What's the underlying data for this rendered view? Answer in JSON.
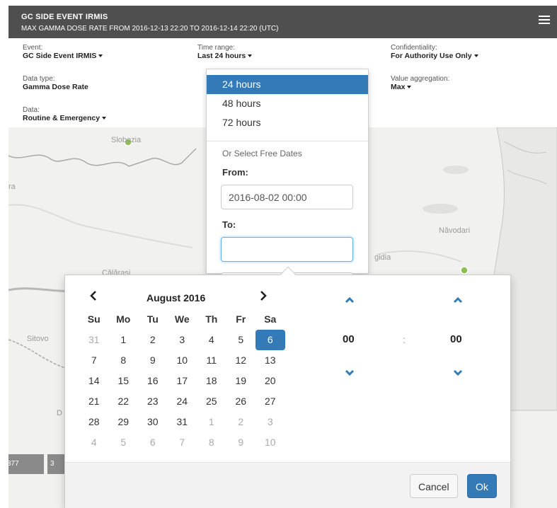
{
  "header": {
    "title": "GC SIDE EVENT IRMIS",
    "subtitle": "MAX GAMMA DOSE RATE FROM 2016-12-13 22:20 TO 2016-12-14 22:20 (UTC)"
  },
  "filters": {
    "event": {
      "label": "Event:",
      "value": "GC Side Event IRMIS"
    },
    "data_type": {
      "label": "Data type:",
      "value": "Gamma Dose Rate"
    },
    "data": {
      "label": "Data:",
      "value": "Routine & Emergency"
    },
    "time_range": {
      "label": "Time range:",
      "value": "Last 24 hours"
    },
    "confidentiality": {
      "label": "Confidentiality:",
      "value": "For Authority Use Only"
    },
    "aggregation": {
      "label": "Value aggregation:",
      "value": "Max"
    }
  },
  "dropdown": {
    "options": [
      "24 hours",
      "48 hours",
      "72 hours"
    ],
    "selected_index": 0,
    "free_dates_hint": "Or Select Free Dates",
    "from_label": "From:",
    "from_value": "2016-08-02 00:00",
    "to_label": "To:",
    "to_value": ""
  },
  "map": {
    "labels": [
      "Slobozia",
      "Călărași",
      "Sitovo",
      "Năvodari",
      "gidia",
      "ra",
      "D"
    ],
    "scale_values": [
      "877",
      "3"
    ],
    "marker_color": "#8cc152"
  },
  "datepicker": {
    "month_title": "August 2016",
    "weekdays": [
      "Su",
      "Mo",
      "Tu",
      "We",
      "Th",
      "Fr",
      "Sa"
    ],
    "weeks": [
      [
        {
          "d": "31",
          "m": true
        },
        {
          "d": "1"
        },
        {
          "d": "2"
        },
        {
          "d": "3"
        },
        {
          "d": "4"
        },
        {
          "d": "5"
        },
        {
          "d": "6",
          "s": true
        }
      ],
      [
        {
          "d": "7"
        },
        {
          "d": "8"
        },
        {
          "d": "9"
        },
        {
          "d": "10"
        },
        {
          "d": "11"
        },
        {
          "d": "12"
        },
        {
          "d": "13"
        }
      ],
      [
        {
          "d": "14"
        },
        {
          "d": "15"
        },
        {
          "d": "16"
        },
        {
          "d": "17"
        },
        {
          "d": "18"
        },
        {
          "d": "19"
        },
        {
          "d": "20"
        }
      ],
      [
        {
          "d": "21"
        },
        {
          "d": "22"
        },
        {
          "d": "23"
        },
        {
          "d": "24"
        },
        {
          "d": "25"
        },
        {
          "d": "26"
        },
        {
          "d": "27"
        }
      ],
      [
        {
          "d": "28"
        },
        {
          "d": "29"
        },
        {
          "d": "30"
        },
        {
          "d": "31"
        },
        {
          "d": "1",
          "m": true
        },
        {
          "d": "2",
          "m": true
        },
        {
          "d": "3",
          "m": true
        }
      ],
      [
        {
          "d": "4",
          "m": true
        },
        {
          "d": "5",
          "m": true
        },
        {
          "d": "6",
          "m": true
        },
        {
          "d": "7",
          "m": true
        },
        {
          "d": "8",
          "m": true
        },
        {
          "d": "9",
          "m": true
        },
        {
          "d": "10",
          "m": true
        }
      ]
    ],
    "hours": "00",
    "minutes": "00",
    "time_separator": ":",
    "cancel_label": "Cancel",
    "ok_label": "Ok"
  },
  "colors": {
    "header_bg": "#4f4f4f",
    "accent": "#337ab7",
    "chevron": "#337ab7"
  }
}
